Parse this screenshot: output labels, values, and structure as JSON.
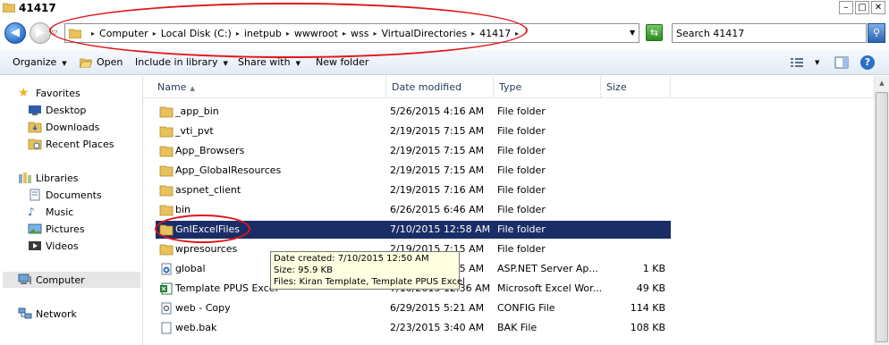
{
  "window": {
    "title": "41417",
    "min_label": "–",
    "max_label": "□",
    "close_label": "✕"
  },
  "address_bar": {
    "breadcrumbs": [
      "Computer",
      "Local Disk (C:)",
      "inetpub",
      "wwwroot",
      "wss",
      "VirtualDirectories",
      "41417"
    ],
    "search_placeholder": "Search 41417"
  },
  "toolbar": {
    "organize": "Organize",
    "open": "Open",
    "include_in_library": "Include in library",
    "share_with": "Share with",
    "new_folder": "New folder",
    "help": "?"
  },
  "nav_pane": {
    "favorites": "Favorites",
    "desktop": "Desktop",
    "downloads": "Downloads",
    "recent_places": "Recent Places",
    "libraries": "Libraries",
    "documents": "Documents",
    "music": "Music",
    "pictures": "Pictures",
    "videos": "Videos",
    "computer": "Computer",
    "network": "Network"
  },
  "columns": {
    "name": "Name",
    "date_modified": "Date modified",
    "type": "Type",
    "size": "Size"
  },
  "files": [
    {
      "name": "_app_bin",
      "date": "5/26/2015 4:16 AM",
      "type": "File folder",
      "size": "",
      "icon": "folder-icon"
    },
    {
      "name": "_vti_pvt",
      "date": "2/19/2015 7:15 AM",
      "type": "File folder",
      "size": "",
      "icon": "folder-icon"
    },
    {
      "name": "App_Browsers",
      "date": "2/19/2015 7:15 AM",
      "type": "File folder",
      "size": "",
      "icon": "folder-icon"
    },
    {
      "name": "App_GlobalResources",
      "date": "2/19/2015 7:15 AM",
      "type": "File folder",
      "size": "",
      "icon": "folder-icon"
    },
    {
      "name": "aspnet_client",
      "date": "2/19/2015 7:16 AM",
      "type": "File folder",
      "size": "",
      "icon": "folder-icon"
    },
    {
      "name": "bin",
      "date": "6/26/2015 6:46 AM",
      "type": "File folder",
      "size": "",
      "icon": "folder-icon"
    },
    {
      "name": "GnIExcelFiles",
      "date": "7/10/2015 12:58 AM",
      "type": "File folder",
      "size": "",
      "icon": "folder-icon"
    },
    {
      "name": "wpresources",
      "date": "2/19/2015 7:15 AM",
      "type": "File folder",
      "size": "",
      "icon": "folder-icon"
    },
    {
      "name": "global",
      "date": "2/19/2015 7:15 AM",
      "type": "ASP.NET Server Ap...",
      "size": "1 KB",
      "icon": "aspnet-file-icon"
    },
    {
      "name": "Template PPUS Excel",
      "date": "7/10/2015 12:36 AM",
      "type": "Microsoft Excel Wor...",
      "size": "49 KB",
      "icon": "excel-file-icon"
    },
    {
      "name": "web - Copy",
      "date": "6/29/2015 5:21 AM",
      "type": "CONFIG File",
      "size": "114 KB",
      "icon": "config-file-icon"
    },
    {
      "name": "web.bak",
      "date": "2/23/2015 3:40 AM",
      "type": "BAK File",
      "size": "108 KB",
      "icon": "generic-file-icon"
    }
  ],
  "tooltip": {
    "created": "Date created: 7/10/2015 12:50 AM",
    "size": "Size: 95.9 KB",
    "files": "Files: Kiran Template, Template PPUS Excel"
  },
  "colors": {
    "selection": "#1a2d66",
    "annotation": "#e0161a",
    "folder": "#e8c15a"
  }
}
